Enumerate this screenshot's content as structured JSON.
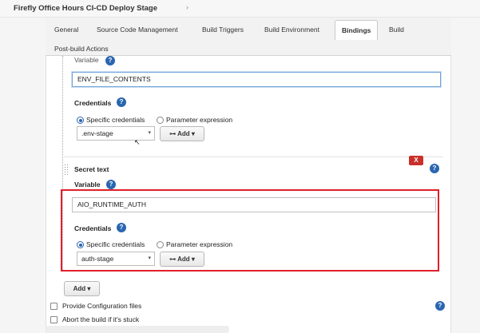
{
  "breadcrumb": {
    "title": "Firefly Office Hours CI-CD Deploy Stage",
    "arrow": "›"
  },
  "tabs": [
    {
      "label": "General"
    },
    {
      "label": "Source Code Management"
    },
    {
      "label": "Build Triggers"
    },
    {
      "label": "Build Environment"
    },
    {
      "label": "Bindings"
    },
    {
      "label": "Build"
    },
    {
      "label": "Post-build Actions"
    }
  ],
  "active_tab": "Bindings",
  "binding1": {
    "variable_label": "Variable",
    "variable_value": "ENV_FILE_CONTENTS",
    "credentials_label": "Credentials",
    "radio_specific": "Specific credentials",
    "radio_param": "Parameter expression",
    "credential_selected": ".env-stage",
    "add_label": "Add"
  },
  "binding2": {
    "section_title": "Secret text",
    "delete_label": "X",
    "variable_label": "Variable",
    "variable_value": "AIO_RUNTIME_AUTH",
    "credentials_label": "Credentials",
    "radio_specific": "Specific credentials",
    "radio_param": "Parameter expression",
    "credential_selected": "auth-stage",
    "add_label": "Add"
  },
  "add_binding_label": "Add",
  "options": [
    {
      "label": "Provide Configuration files",
      "checked": false
    },
    {
      "label": "Abort the build if it's stuck",
      "checked": false
    }
  ],
  "help_glyph": "?",
  "caret_glyph": "▾",
  "key_glyph": "⊶",
  "colors": {
    "accent": "#2a66b0",
    "highlight": "#e0202a",
    "delete": "#c9302c"
  }
}
